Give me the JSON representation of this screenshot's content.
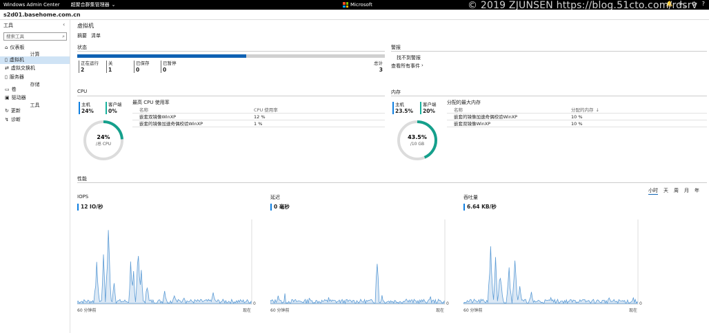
{
  "topbar": {
    "app_title": "Windows Admin Center",
    "connection": "超聚合群集管理器",
    "brand": "Microsoft",
    "icons": [
      "bell-icon",
      "terminal-icon",
      "gear-icon",
      "help-icon"
    ]
  },
  "watermark": "© 2019 ZJUNSEN https://blog.51cto.com/rdsrv",
  "host": "s2d01.basehome.com.cn",
  "sidebar": {
    "header": "工具",
    "search_placeholder": "搜索工具",
    "items": [
      {
        "label": "仪表板",
        "icon": "home-icon"
      },
      {
        "group": "计算"
      },
      {
        "label": "虚拟机",
        "icon": "vm-icon",
        "active": true
      },
      {
        "label": "虚拟交换机",
        "icon": "switch-icon"
      },
      {
        "label": "服务器",
        "icon": "server-icon"
      },
      {
        "group": "存储"
      },
      {
        "label": "卷",
        "icon": "volume-icon"
      },
      {
        "label": "驱动器",
        "icon": "drive-icon"
      },
      {
        "group": "工具"
      },
      {
        "label": "更新",
        "icon": "update-icon"
      },
      {
        "label": "诊断",
        "icon": "diagnostics-icon"
      }
    ]
  },
  "main": {
    "title": "虚拟机",
    "tabs": [
      "摘要",
      "清单"
    ],
    "status": {
      "label": "状态",
      "running_fraction": 0.55,
      "stats": [
        {
          "label": "正在运行",
          "value": "2"
        },
        {
          "label": "关",
          "value": "1"
        },
        {
          "label": "已保存",
          "value": "0"
        },
        {
          "label": "已暂停",
          "value": "0"
        }
      ],
      "total_label": "总计",
      "total_value": "3"
    },
    "alerts": {
      "label": "警报",
      "none": "找不到警报",
      "link": "查看所有事件"
    },
    "cpu": {
      "label": "CPU",
      "host_label": "主机",
      "host_value": "24%",
      "guest_label": "客户端",
      "guest_value": "0%",
      "ring_value": "24%",
      "ring_sub": "/总 CPU",
      "ring_fraction": 0.24,
      "table_title": "最高 CPU 使用率",
      "col_name": "名称",
      "col_value": "CPU 使用率",
      "rows": [
        {
          "name": "嵌套双镜像WinXP",
          "value": "12 %"
        },
        {
          "name": "嵌套的镜像加速奇偶校验WinXP",
          "value": "1 %"
        }
      ]
    },
    "memory": {
      "label": "内存",
      "host_label": "主机",
      "host_value": "23.5%",
      "guest_label": "客户端",
      "guest_value": "20%",
      "ring_value": "43.5%",
      "ring_sub": "/10 GB",
      "ring_fraction": 0.435,
      "table_title": "分配的最大内存",
      "col_name": "名称",
      "col_value": "分配的内存",
      "rows": [
        {
          "name": "嵌套的镜像加速奇偶校验WinXP",
          "value": "10 %"
        },
        {
          "name": "嵌套双镜像WinXP",
          "value": "10 %"
        }
      ]
    },
    "performance": {
      "label": "性能",
      "ranges": [
        "小时",
        "天",
        "周",
        "月",
        "年"
      ],
      "selected_range": "小时",
      "charts": [
        {
          "title": "IOPS",
          "value": "12 IO/秒",
          "x_start": "60 分钟前",
          "x_end": "现在",
          "y_zero": "0"
        },
        {
          "title": "延迟",
          "value": "0 毫秒",
          "x_start": "60 分钟前",
          "x_end": "现在",
          "y_zero": "0"
        },
        {
          "title": "吞吐量",
          "value": "6.64 KB/秒",
          "x_start": "60 分钟前",
          "x_end": "现在",
          "y_zero": "0"
        }
      ]
    }
  }
}
